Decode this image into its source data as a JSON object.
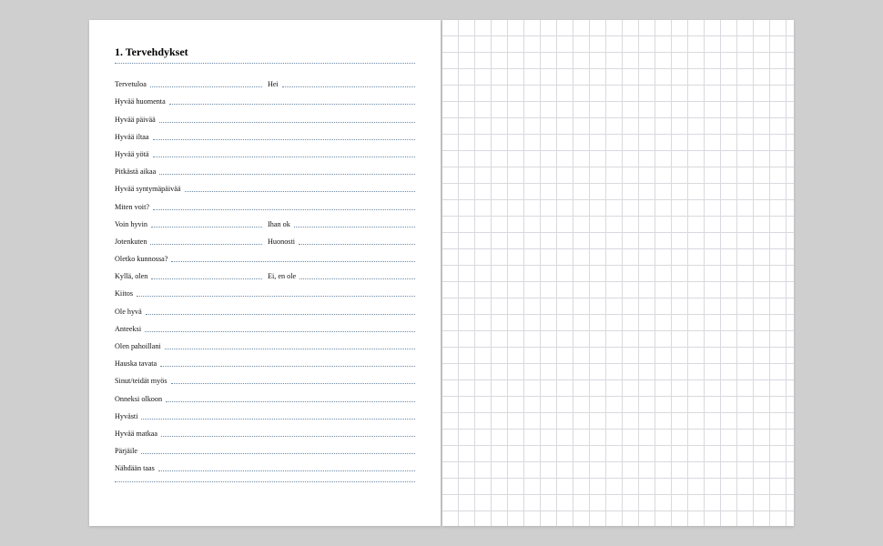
{
  "heading": "1. Tervehdykset",
  "rows": [
    {
      "cols": [
        "Tervetuloa",
        "Hei"
      ]
    },
    {
      "cols": [
        "Hyvää huomenta"
      ]
    },
    {
      "cols": [
        "Hyvää päivää"
      ]
    },
    {
      "cols": [
        "Hyvää iltaa"
      ]
    },
    {
      "cols": [
        "Hyvää yötä"
      ]
    },
    {
      "cols": [
        "Pitkästä aikaa"
      ]
    },
    {
      "cols": [
        "Hyvää syntymäpäivää"
      ]
    },
    {
      "cols": [
        "Miten voit?"
      ]
    },
    {
      "cols": [
        "Voin hyvin",
        "Ihan ok"
      ]
    },
    {
      "cols": [
        "Jotenkuten",
        "Huonosti"
      ]
    },
    {
      "cols": [
        "Oletko kunnossa?"
      ]
    },
    {
      "cols": [
        "Kyllä, olen",
        "Ei, en ole"
      ]
    },
    {
      "cols": [
        "Kiitos"
      ]
    },
    {
      "cols": [
        "Ole hyvä"
      ]
    },
    {
      "cols": [
        "Anteeksi"
      ]
    },
    {
      "cols": [
        "Olen pahoillani"
      ]
    },
    {
      "cols": [
        "Hauska tavata"
      ]
    },
    {
      "cols": [
        "Sinut/teidät myös"
      ]
    },
    {
      "cols": [
        "Onneksi olkoon"
      ]
    },
    {
      "cols": [
        "Hyvästi"
      ]
    },
    {
      "cols": [
        "Hyvää matkaa"
      ]
    },
    {
      "cols": [
        "Pärjäile"
      ]
    },
    {
      "cols": [
        "Nähdään taas"
      ]
    }
  ]
}
